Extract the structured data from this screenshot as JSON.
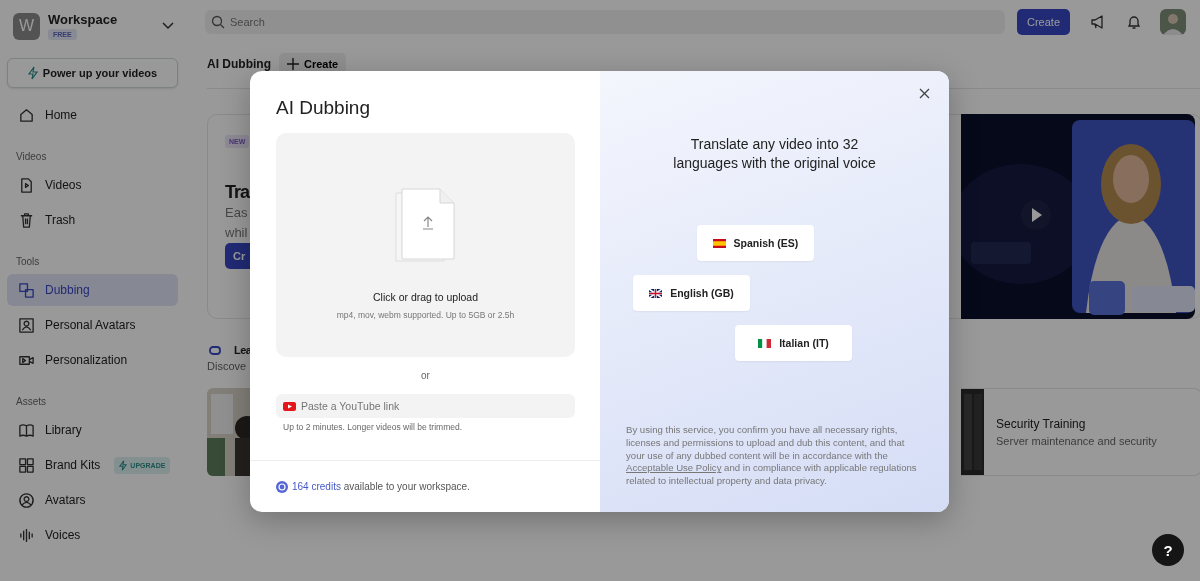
{
  "sidebar": {
    "workspace": {
      "initial": "W",
      "name": "Workspace",
      "plan": "FREE"
    },
    "promo_button": "Power up your videos",
    "sections": [
      {
        "items": [
          {
            "label": "Home",
            "selected": false
          }
        ]
      },
      {
        "title": "Videos",
        "items": [
          {
            "label": "Videos",
            "selected": false
          },
          {
            "label": "Trash",
            "selected": false
          }
        ]
      },
      {
        "title": "Tools",
        "items": [
          {
            "label": "Dubbing",
            "selected": true
          },
          {
            "label": "Personal Avatars",
            "selected": false
          },
          {
            "label": "Personalization",
            "selected": false
          }
        ]
      },
      {
        "title": "Assets",
        "items": [
          {
            "label": "Library",
            "selected": false
          },
          {
            "label": "Brand Kits",
            "selected": false,
            "badge": "UPGRADE"
          },
          {
            "label": "Avatars",
            "selected": false
          },
          {
            "label": "Voices",
            "selected": false
          }
        ]
      }
    ]
  },
  "topbar": {
    "search": {
      "placeholder": "Search"
    },
    "create_button": "Create"
  },
  "page": {
    "title": "AI Dubbing",
    "create_button": "Create"
  },
  "hero": {
    "badge": "NEW",
    "title": "Tra",
    "description_lines": [
      "Eas",
      "whil"
    ],
    "button": "Cr"
  },
  "learn": {
    "title": "Lea",
    "subtitle": "Discove",
    "card": {
      "title": "Security Training",
      "subtitle": "Server maintenance and security"
    }
  },
  "help_button": "?",
  "modal": {
    "title": "AI Dubbing",
    "upload": {
      "title": "Click or drag to upload",
      "hint": "mp4, mov, webm supported. Up to 5GB or 2.5h"
    },
    "separator": "or",
    "youtube": {
      "placeholder": "Paste a YouTube link",
      "hint": "Up to 2 minutes. Longer videos will be trimmed."
    },
    "credits": {
      "amount": "164 credits",
      "text": "available to your workspace."
    },
    "headline": "Translate any video into 32 languages with the original voice",
    "languages": [
      {
        "label": "Spanish (ES)"
      },
      {
        "label": "English (GB)"
      },
      {
        "label": "Italian (IT)"
      }
    ],
    "legal": {
      "before": "By using this service, you confirm you have all necessary rights, licenses and permissions to upload and dub this content, and that your use of any dubbed content will be in accordance with the",
      "link": "Acceptable Use Policy",
      "after": "and in compliance with applicable regulations related to intellectual property and data privacy."
    }
  }
}
